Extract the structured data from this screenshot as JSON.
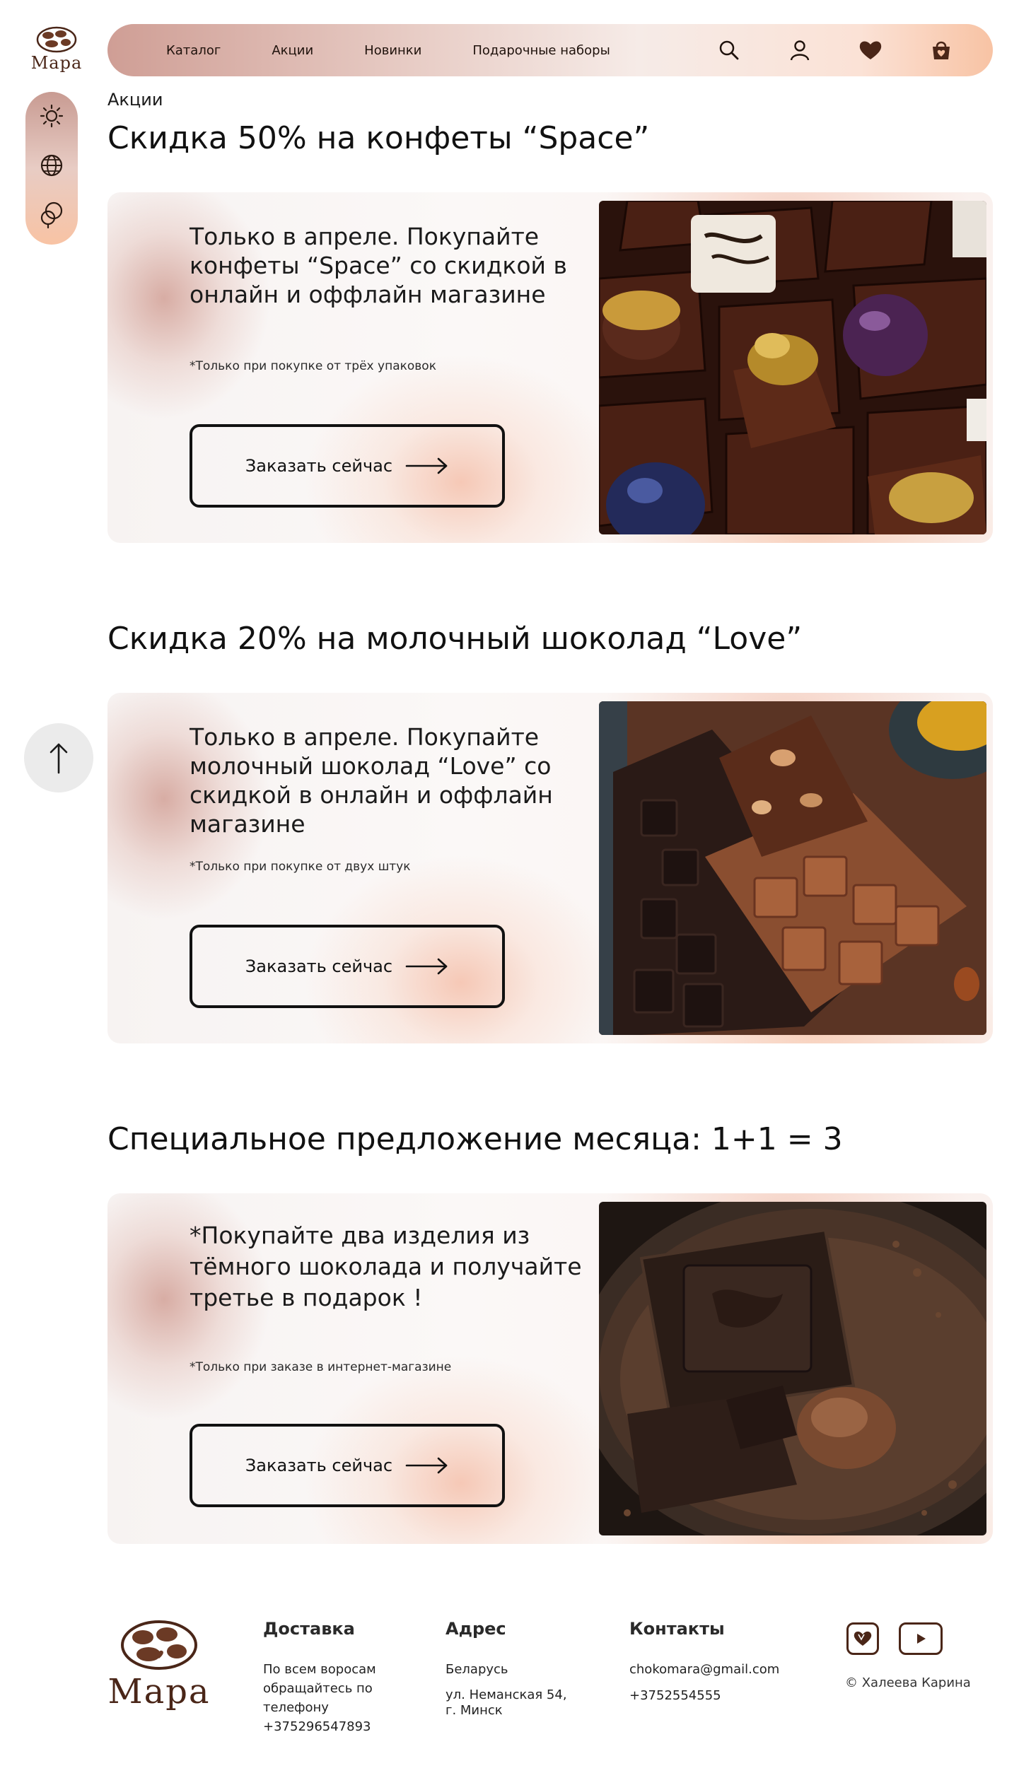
{
  "brand": {
    "name": "Мара",
    "color": "#4a2618"
  },
  "nav": {
    "links": [
      "Каталог",
      "Акции",
      "Новинки",
      "Подарочные наборы"
    ],
    "icons": [
      "search-icon",
      "user-icon",
      "heart-icon",
      "cart-icon"
    ]
  },
  "sidebar": {
    "icons": [
      "sun-icon",
      "globe-icon",
      "palette-icon"
    ]
  },
  "breadcrumb": "Акции",
  "promos": [
    {
      "title": "Скидка 50% на конфеты “Space”",
      "description": "Только в апреле. Покупайте конфеты “Space” со скидкой в онлайн и оффлайн магазине",
      "note": "*Только при покупке от трёх упаковок",
      "button": "Заказать сейчас"
    },
    {
      "title": "Скидка 20% на молочный шоколад “Love”",
      "description": "Только в апреле. Покупайте молочный шоколад “Love” со скидкой в онлайн и оффлайн магазине",
      "note": "*Только при покупке от двух штук",
      "button": "Заказать сейчас"
    },
    {
      "title": "Специальное предложение месяца: 1+1 = 3",
      "description": "*Покупайте два изделия из тёмного шоколада и получайте третье в подарок !",
      "note": "*Только при заказе в интернет-магазине",
      "button": "Заказать сейчас"
    }
  ],
  "footer": {
    "delivery": {
      "heading": "Доставка",
      "lines": [
        "По всем воросам",
        "обращайтесь по",
        "телефону",
        "+375296547893"
      ]
    },
    "address": {
      "heading": "Адрес",
      "country": "Беларусь",
      "street": "ул. Неманская 54,",
      "city": "г. Минск"
    },
    "contacts": {
      "heading": "Контакты",
      "email": "chokomara@gmail.com",
      "phone": "+3752554555"
    },
    "copyright": "© Халеева Карина"
  }
}
